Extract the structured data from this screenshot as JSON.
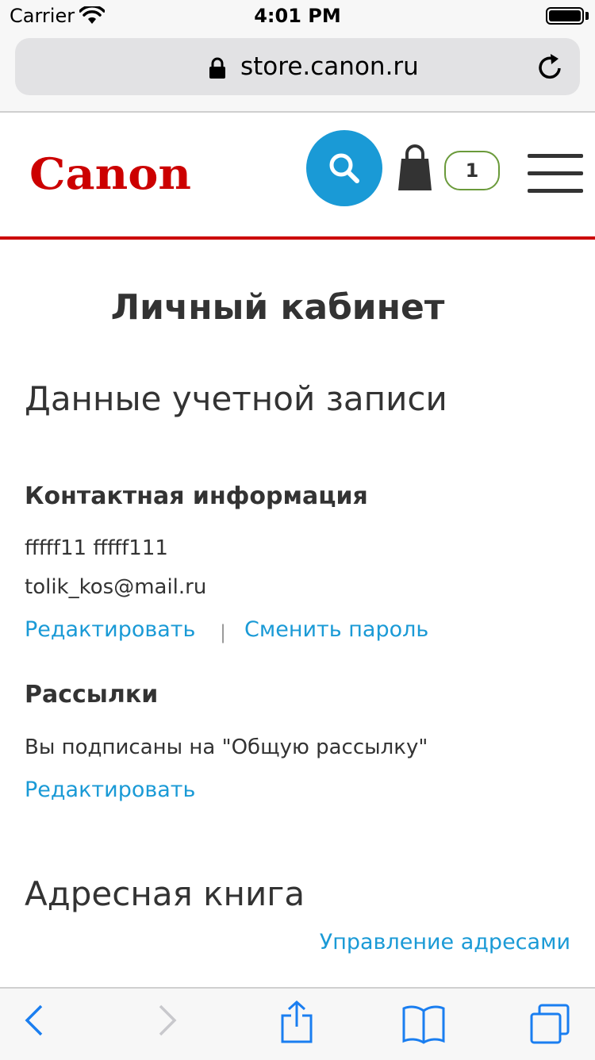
{
  "status_bar": {
    "carrier": "Carrier",
    "time": "4:01 PM"
  },
  "browser": {
    "url": "store.canon.ru"
  },
  "header": {
    "logo_text": "Canon",
    "cart_count": "1"
  },
  "page": {
    "title": "Личный кабинет"
  },
  "account": {
    "heading": "Данные учетной записи",
    "contact": {
      "heading": "Контактная информация",
      "name": "fffff11 fffff111",
      "email": "tolik_kos@mail.ru",
      "edit_link": "Редактировать",
      "separator": "|",
      "change_password_link": "Сменить пароль"
    },
    "newsletters": {
      "heading": "Рассылки",
      "text": "Вы подписаны на \"Общую рассылку\"",
      "edit_link": "Редактировать"
    }
  },
  "address_book": {
    "heading": "Адресная книга",
    "manage_link": "Управление адресами"
  },
  "colors": {
    "brand_red": "#cc0000",
    "accent_blue": "#1a9ad6",
    "cart_border": "#6a9a3a"
  },
  "icons": [
    "wifi-icon",
    "battery-icon",
    "lock-icon",
    "reload-icon",
    "search-icon",
    "shopping-bag-icon",
    "hamburger-menu-icon",
    "back-icon",
    "forward-icon",
    "share-icon",
    "bookmarks-icon",
    "tabs-icon"
  ]
}
